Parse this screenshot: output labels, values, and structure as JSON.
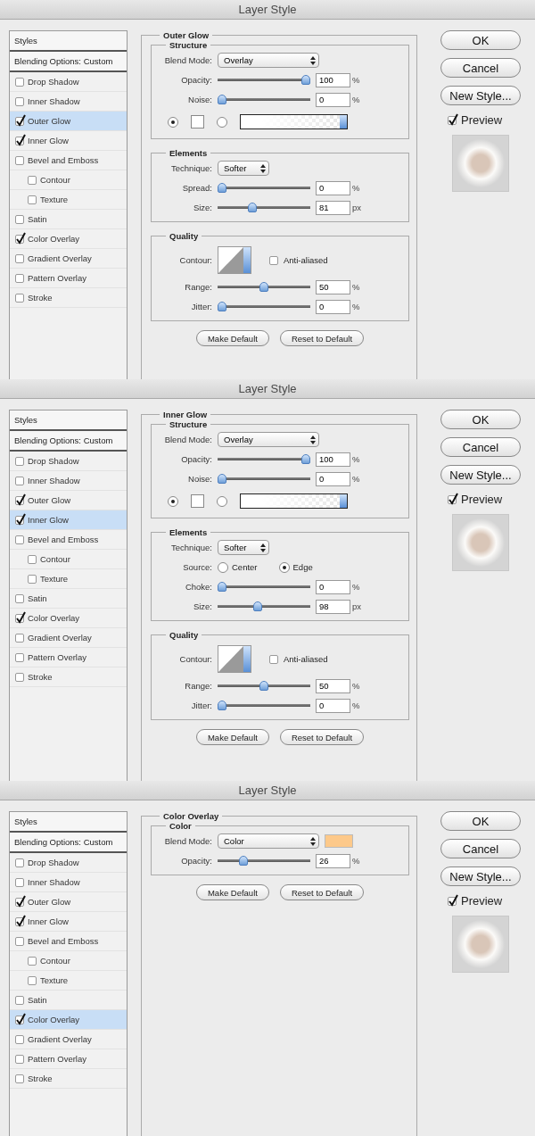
{
  "dialogs": [
    {
      "title": "Layer Style",
      "styles_header": "Styles",
      "blending_options": "Blending Options: Custom",
      "effects": [
        {
          "label": "Drop Shadow",
          "checked": false,
          "selected": false
        },
        {
          "label": "Inner Shadow",
          "checked": false,
          "selected": false
        },
        {
          "label": "Outer Glow",
          "checked": true,
          "selected": true
        },
        {
          "label": "Inner Glow",
          "checked": true,
          "selected": false
        },
        {
          "label": "Bevel and Emboss",
          "checked": false,
          "selected": false,
          "children": [
            {
              "label": "Contour",
              "checked": false,
              "selected": false
            },
            {
              "label": "Texture",
              "checked": false,
              "selected": false
            }
          ]
        },
        {
          "label": "Satin",
          "checked": false,
          "selected": false
        },
        {
          "label": "Color Overlay",
          "checked": true,
          "selected": false
        },
        {
          "label": "Gradient Overlay",
          "checked": false,
          "selected": false
        },
        {
          "label": "Pattern Overlay",
          "checked": false,
          "selected": false
        },
        {
          "label": "Stroke",
          "checked": false,
          "selected": false
        }
      ],
      "panel": {
        "title": "Outer Glow",
        "groups": [
          {
            "title": "Structure",
            "rows": [
              {
                "kind": "select",
                "label": "Blend Mode:",
                "value": "Overlay"
              },
              {
                "kind": "slider",
                "label": "Opacity:",
                "level": 1,
                "value": "100",
                "unit": "%"
              },
              {
                "kind": "slider",
                "label": "Noise:",
                "level": 0,
                "value": "0",
                "unit": "%"
              },
              {
                "kind": "fill",
                "options": [
                  {
                    "kind": "color",
                    "selected": true
                  },
                  {
                    "kind": "gradient",
                    "selected": false
                  }
                ]
              }
            ]
          },
          {
            "title": "Elements",
            "rows": [
              {
                "kind": "select",
                "label": "Technique:",
                "value": "Softer"
              },
              {
                "kind": "slider",
                "label": "Spread:",
                "level": 0,
                "value": "0",
                "unit": "%"
              },
              {
                "kind": "slider",
                "label": "Size:",
                "level": 0.36,
                "value": "81",
                "unit": "px"
              }
            ]
          },
          {
            "title": "Quality",
            "rows": [
              {
                "kind": "contour",
                "label": "Contour:",
                "checkbox": {
                  "label": "Anti-aliased",
                  "checked": false
                }
              },
              {
                "kind": "slider",
                "label": "Range:",
                "level": 0.5,
                "value": "50",
                "unit": "%"
              },
              {
                "kind": "slider",
                "label": "Jitter:",
                "level": 0,
                "value": "0",
                "unit": "%"
              }
            ]
          }
        ],
        "buttons": [
          "Make Default",
          "Reset to Default"
        ]
      },
      "actions": [
        "OK",
        "Cancel",
        "New Style..."
      ],
      "preview": {
        "label": "Preview",
        "checked": true
      }
    },
    {
      "title": "Layer Style",
      "styles_header": "Styles",
      "blending_options": "Blending Options: Custom",
      "effects": [
        {
          "label": "Drop Shadow",
          "checked": false,
          "selected": false
        },
        {
          "label": "Inner Shadow",
          "checked": false,
          "selected": false
        },
        {
          "label": "Outer Glow",
          "checked": true,
          "selected": false
        },
        {
          "label": "Inner Glow",
          "checked": true,
          "selected": true
        },
        {
          "label": "Bevel and Emboss",
          "checked": false,
          "selected": false,
          "children": [
            {
              "label": "Contour",
              "checked": false,
              "selected": false
            },
            {
              "label": "Texture",
              "checked": false,
              "selected": false
            }
          ]
        },
        {
          "label": "Satin",
          "checked": false,
          "selected": false
        },
        {
          "label": "Color Overlay",
          "checked": true,
          "selected": false
        },
        {
          "label": "Gradient Overlay",
          "checked": false,
          "selected": false
        },
        {
          "label": "Pattern Overlay",
          "checked": false,
          "selected": false
        },
        {
          "label": "Stroke",
          "checked": false,
          "selected": false
        }
      ],
      "panel": {
        "title": "Inner Glow",
        "groups": [
          {
            "title": "Structure",
            "rows": [
              {
                "kind": "select",
                "label": "Blend Mode:",
                "value": "Overlay"
              },
              {
                "kind": "slider",
                "label": "Opacity:",
                "level": 1,
                "value": "100",
                "unit": "%"
              },
              {
                "kind": "slider",
                "label": "Noise:",
                "level": 0,
                "value": "0",
                "unit": "%"
              },
              {
                "kind": "fill",
                "options": [
                  {
                    "kind": "color",
                    "selected": true
                  },
                  {
                    "kind": "gradient",
                    "selected": false
                  }
                ]
              }
            ]
          },
          {
            "title": "Elements",
            "rows": [
              {
                "kind": "select",
                "label": "Technique:",
                "value": "Softer"
              },
              {
                "kind": "radios",
                "label": "Source:",
                "options": [
                  {
                    "label": "Center",
                    "selected": false
                  },
                  {
                    "label": "Edge",
                    "selected": true
                  }
                ]
              },
              {
                "kind": "slider",
                "label": "Choke:",
                "level": 0,
                "value": "0",
                "unit": "%"
              },
              {
                "kind": "slider",
                "label": "Size:",
                "level": 0.43,
                "value": "98",
                "unit": "px"
              }
            ]
          },
          {
            "title": "Quality",
            "rows": [
              {
                "kind": "contour",
                "label": "Contour:",
                "checkbox": {
                  "label": "Anti-aliased",
                  "checked": false
                }
              },
              {
                "kind": "slider",
                "label": "Range:",
                "level": 0.5,
                "value": "50",
                "unit": "%"
              },
              {
                "kind": "slider",
                "label": "Jitter:",
                "level": 0,
                "value": "0",
                "unit": "%"
              }
            ]
          }
        ],
        "buttons": [
          "Make Default",
          "Reset to Default"
        ]
      },
      "actions": [
        "OK",
        "Cancel",
        "New Style..."
      ],
      "preview": {
        "label": "Preview",
        "checked": true
      }
    },
    {
      "title": "Layer Style",
      "styles_header": "Styles",
      "blending_options": "Blending Options: Custom",
      "effects": [
        {
          "label": "Drop Shadow",
          "checked": false,
          "selected": false
        },
        {
          "label": "Inner Shadow",
          "checked": false,
          "selected": false
        },
        {
          "label": "Outer Glow",
          "checked": true,
          "selected": false
        },
        {
          "label": "Inner Glow",
          "checked": true,
          "selected": false
        },
        {
          "label": "Bevel and Emboss",
          "checked": false,
          "selected": false,
          "children": [
            {
              "label": "Contour",
              "checked": false,
              "selected": false
            },
            {
              "label": "Texture",
              "checked": false,
              "selected": false
            }
          ]
        },
        {
          "label": "Satin",
          "checked": false,
          "selected": false
        },
        {
          "label": "Color Overlay",
          "checked": true,
          "selected": true
        },
        {
          "label": "Gradient Overlay",
          "checked": false,
          "selected": false
        },
        {
          "label": "Pattern Overlay",
          "checked": false,
          "selected": false
        },
        {
          "label": "Stroke",
          "checked": false,
          "selected": false
        }
      ],
      "panel": {
        "title": "Color Overlay",
        "groups": [
          {
            "title": "Color",
            "rows": [
              {
                "kind": "select",
                "label": "Blend Mode:",
                "value": "Color",
                "color": "#fdc98a"
              },
              {
                "kind": "slider",
                "label": "Opacity:",
                "level": 0.26,
                "value": "26",
                "unit": "%"
              }
            ]
          }
        ],
        "buttons": [
          "Make Default",
          "Reset to Default"
        ]
      },
      "actions": [
        "OK",
        "Cancel",
        "New Style..."
      ],
      "preview": {
        "label": "Preview",
        "checked": true
      }
    }
  ]
}
